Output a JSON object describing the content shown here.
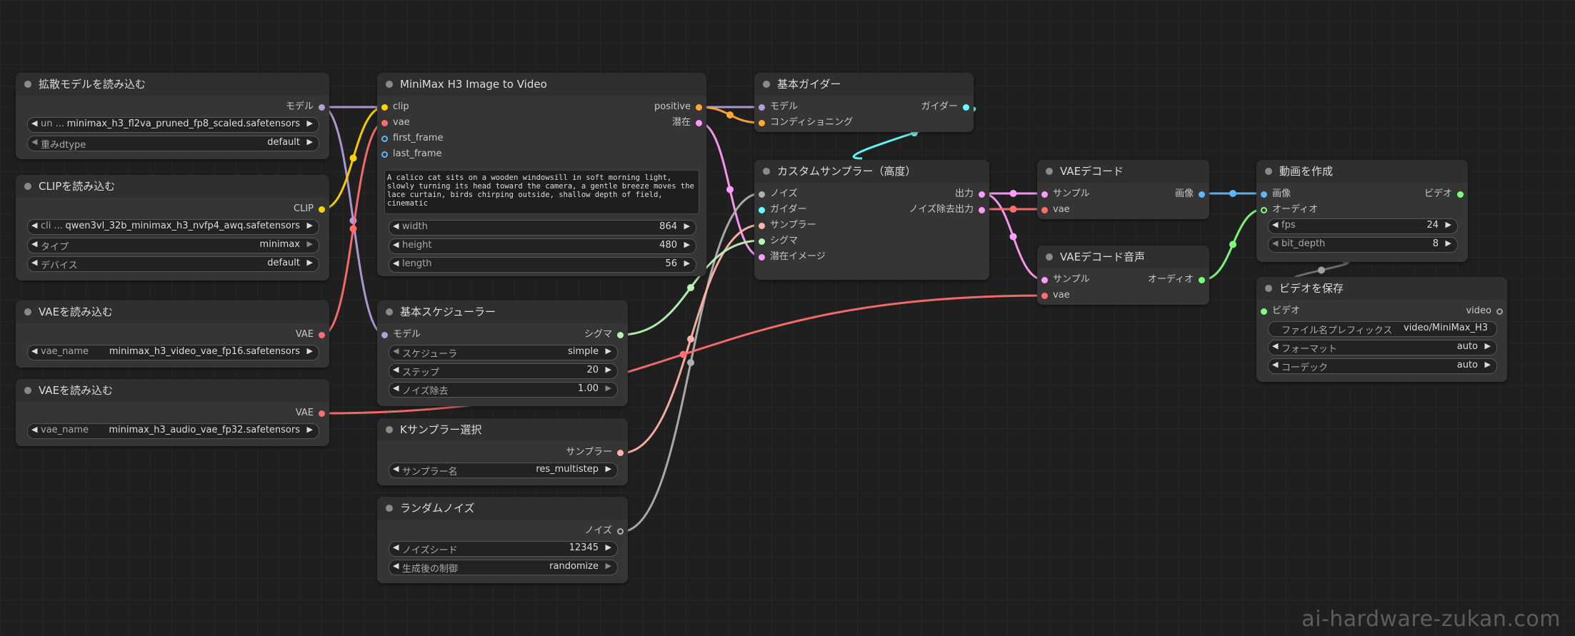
{
  "colors": {
    "model": "#b39ddb",
    "clip": "#ffd400",
    "vae": "#ff6e6e",
    "conditioning": "#ffa931",
    "latent": "#ff9cf9",
    "image": "#64b5f6",
    "sigmas": "#b9f5b5",
    "sampler": "#ffb3a8",
    "guider": "#66ffff",
    "noise": "#b0b0b0",
    "audio": "#7dff7d",
    "video": "#a0a0a0"
  },
  "nodes": {
    "unet": {
      "title": "拡散モデルを読み込む",
      "out_model": "モデル",
      "w1_label": "un ...",
      "w1_value": "minimax_h3_fl2va_pruned_fp8_scaled.safetensors",
      "w2_label": "重みdtype",
      "w2_value": "default"
    },
    "clip": {
      "title": "CLIPを読み込む",
      "out_clip": "CLIP",
      "w1_label": "cli ...",
      "w1_value": "qwen3vl_32b_minimax_h3_nvfp4_awq.safetensors",
      "w2_label": "タイプ",
      "w2_value": "minimax",
      "w3_label": "デバイス",
      "w3_value": "default"
    },
    "vae1": {
      "title": "VAEを読み込む",
      "out_vae": "VAE",
      "w1_label": "vae_name",
      "w1_value": "minimax_h3_video_vae_fp16.safetensors"
    },
    "vae2": {
      "title": "VAEを読み込む",
      "out_vae": "VAE",
      "w1_label": "vae_name",
      "w1_value": "minimax_h3_audio_vae_fp32.safetensors"
    },
    "i2v": {
      "title": "MiniMax H3 Image to Video",
      "in_clip": "clip",
      "in_vae": "vae",
      "in_first": "first_frame",
      "in_last": "last_frame",
      "out_positive": "positive",
      "out_latent": "潜在",
      "prompt": "A calico cat sits on a wooden windowsill in soft morning light, slowly turning its head toward the camera, a gentle breeze moves the lace curtain, birds chirping outside, shallow depth of field, cinematic",
      "w_width_label": "width",
      "w_width_value": "864",
      "w_height_label": "height",
      "w_height_value": "480",
      "w_length_label": "length",
      "w_length_value": "56"
    },
    "sched": {
      "title": "基本スケジューラー",
      "in_model": "モデル",
      "out_sigmas": "シグマ",
      "w1_label": "スケジューラ",
      "w1_value": "simple",
      "w2_label": "ステップ",
      "w2_value": "20",
      "w3_label": "ノイズ除去",
      "w3_value": "1.00"
    },
    "ksel": {
      "title": "Kサンプラー選択",
      "out_sampler": "サンプラー",
      "w1_label": "サンプラー名",
      "w1_value": "res_multistep"
    },
    "noise": {
      "title": "ランダムノイズ",
      "out_noise": "ノイズ",
      "w1_label": "ノイズシード",
      "w1_value": "12345",
      "w2_label": "生成後の制御",
      "w2_value": "randomize"
    },
    "guider": {
      "title": "基本ガイダー",
      "in_model": "モデル",
      "in_cond": "コンディショニング",
      "out_guider": "ガイダー"
    },
    "custom": {
      "title": "カスタムサンプラー（高度）",
      "in_noise": "ノイズ",
      "in_guider": "ガイダー",
      "in_sampler": "サンプラー",
      "in_sigmas": "シグマ",
      "in_latent": "潜在イメージ",
      "out_output": "出力",
      "out_denoised": "ノイズ除去出力"
    },
    "vaedec": {
      "title": "VAEデコード",
      "in_samples": "サンプル",
      "in_vae": "vae",
      "out_image": "画像"
    },
    "vaedec_audio": {
      "title": "VAEデコード音声",
      "in_samples": "サンプル",
      "in_vae": "vae",
      "out_audio": "オーディオ"
    },
    "createvideo": {
      "title": "動画を作成",
      "in_image": "画像",
      "in_audio": "オーディオ",
      "out_video": "ビデオ",
      "w1_label": "fps",
      "w1_value": "24",
      "w2_label": "bit_depth",
      "w2_value": "8"
    },
    "savevideo": {
      "title": "ビデオを保存",
      "in_video": "ビデオ",
      "out_video": "video",
      "w1_label": "ファイル名プレフィックス",
      "w1_value": "video/MiniMax_H3",
      "w2_label": "フォーマット",
      "w2_value": "auto",
      "w3_label": "コーデック",
      "w3_value": "auto"
    }
  },
  "watermark": "ai-hardware-zukan.com"
}
